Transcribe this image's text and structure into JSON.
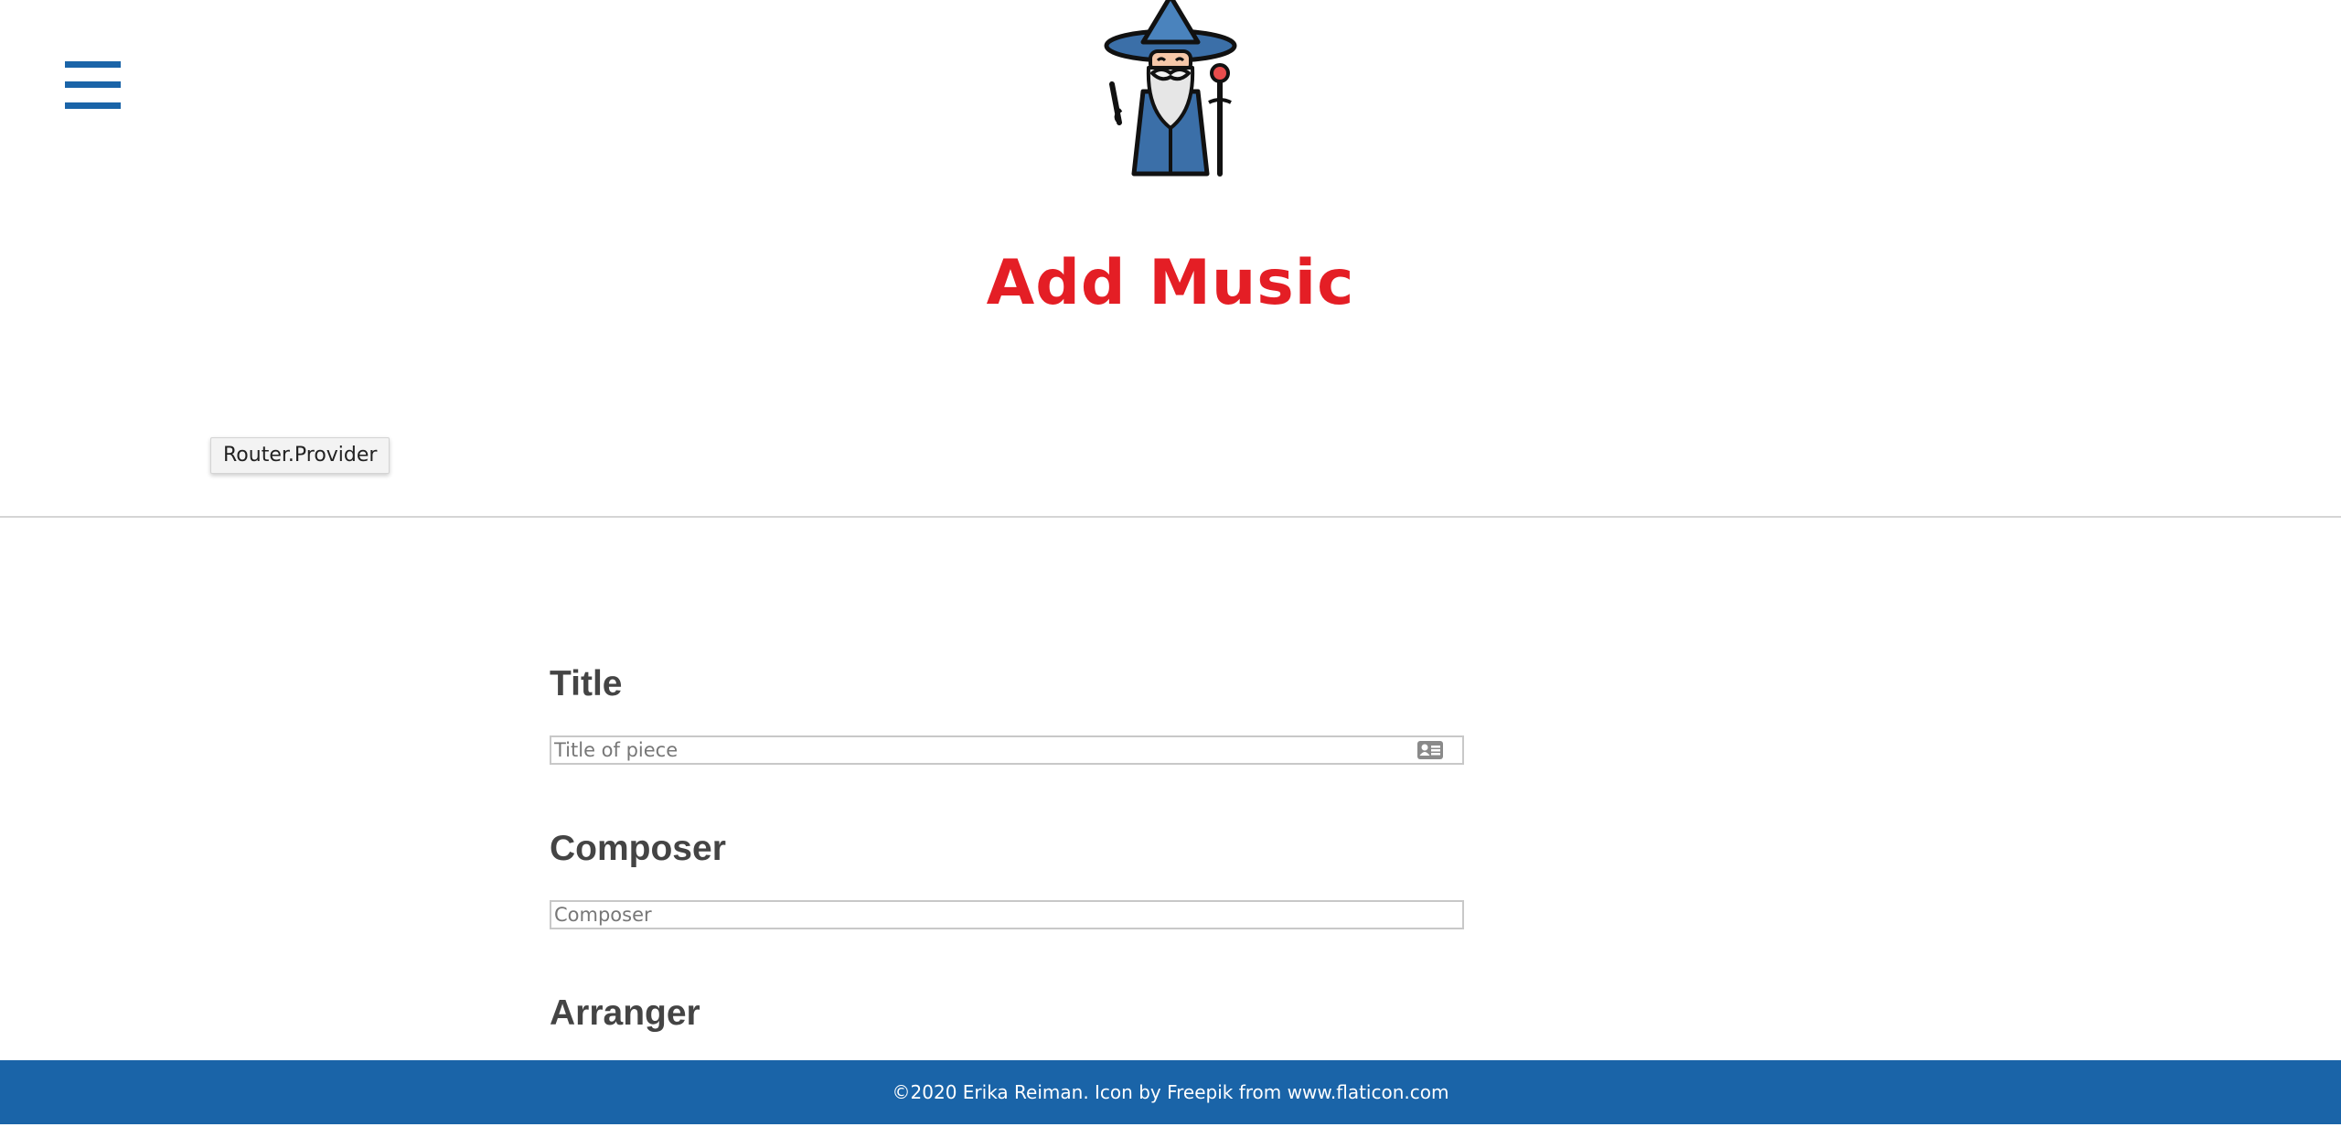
{
  "header": {
    "menu_icon": "hamburger-menu-icon",
    "logo_icon": "wizard-logo-icon",
    "title": "Add Music",
    "title_color": "#e41e25"
  },
  "debug_badge": {
    "label": "Router.Provider"
  },
  "form": {
    "fields": [
      {
        "label": "Title",
        "placeholder": "Title of piece",
        "value": "",
        "trailing_icon": "contact-card-icon"
      },
      {
        "label": "Composer",
        "placeholder": "Composer",
        "value": ""
      },
      {
        "label": "Arranger"
      }
    ]
  },
  "footer": {
    "text": "©2020 Erika Reiman. Icon by Freepik from www.flaticon.com",
    "background": "#1a64a8"
  }
}
